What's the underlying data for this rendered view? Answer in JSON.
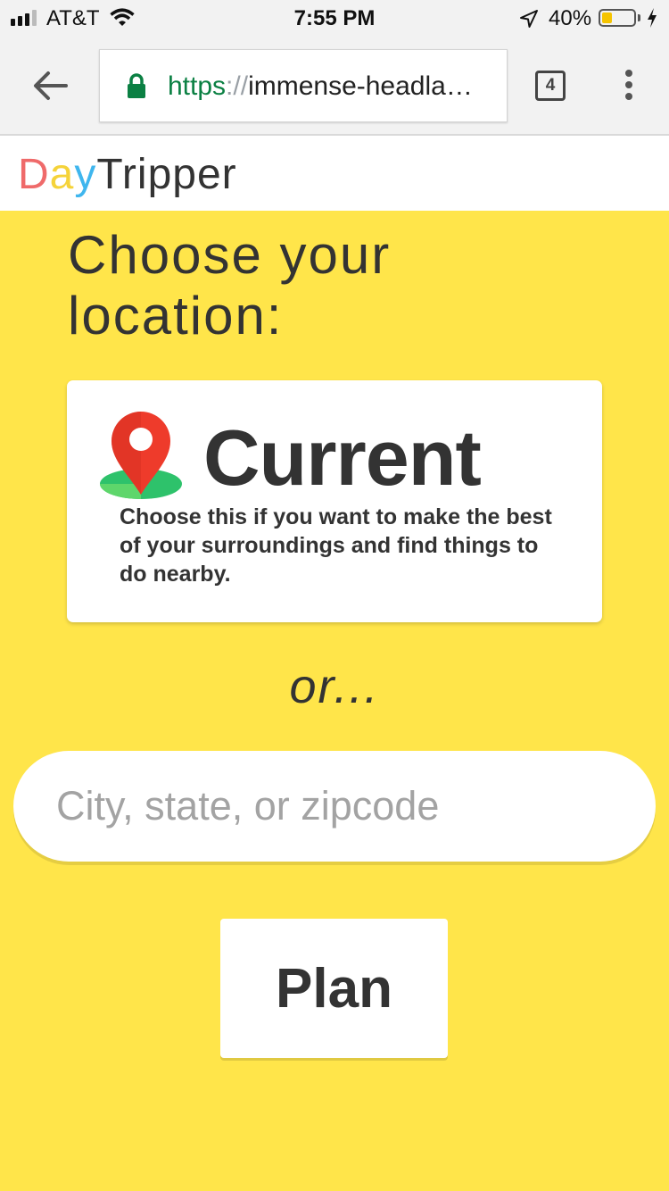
{
  "status_bar": {
    "carrier": "AT&T",
    "time": "7:55 PM",
    "battery_percent": "40%",
    "battery_level": 0.4,
    "icons": [
      "signal-icon",
      "wifi-icon",
      "location-arrow-icon",
      "battery-icon",
      "charging-bolt-icon"
    ]
  },
  "browser": {
    "url_scheme": "https",
    "url_separator": "://",
    "url_host": "immense-headla…",
    "tab_count": "4",
    "secure_color": "#0b8043"
  },
  "site": {
    "logo_letters": [
      "D",
      "a",
      "y"
    ],
    "logo_rest": "Tripper",
    "logo_colors": [
      "#ef6a6a",
      "#f5d33a",
      "#3fb6ee"
    ]
  },
  "main": {
    "heading_line1": "Choose your",
    "heading_line2": "location:",
    "current_card": {
      "title": "Current",
      "description": "Choose this if you want to make the best of your surroundings and find things to do nearby."
    },
    "or_text": "or...",
    "location_input": {
      "placeholder": "City, state, or zipcode",
      "value": ""
    },
    "plan_button": "Plan"
  },
  "colors": {
    "background": "#ffe54a",
    "card": "#ffffff",
    "text": "#333333"
  }
}
